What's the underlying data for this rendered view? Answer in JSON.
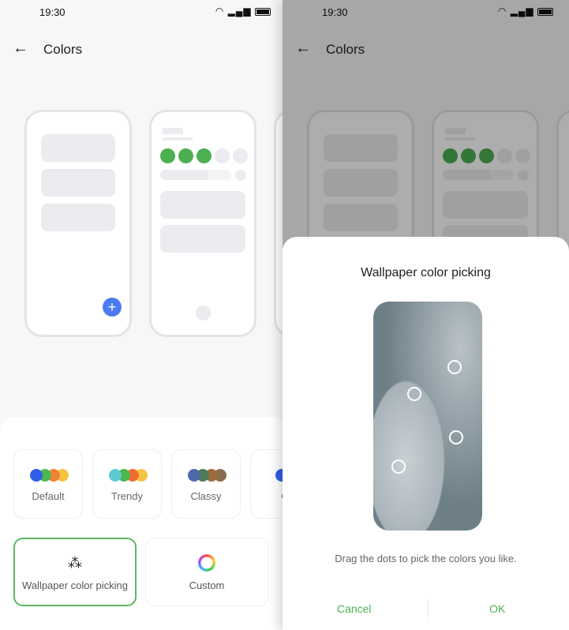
{
  "status": {
    "time": "19:30",
    "icons": "wifi signal battery"
  },
  "header": {
    "back": "←",
    "title": "Colors"
  },
  "themes": [
    {
      "label": "Default",
      "colors": [
        "#2f5ee8",
        "#4db850",
        "#ef8233",
        "#f6c343"
      ]
    },
    {
      "label": "Trendy",
      "colors": [
        "#5dcbd6",
        "#4db850",
        "#ef6c33",
        "#f6c343"
      ]
    },
    {
      "label": "Classy",
      "colors": [
        "#4d6aa8",
        "#4f7a57",
        "#9c6b3d",
        "#8a6b4d"
      ]
    },
    {
      "label": "C",
      "colors": [
        "#2f5ee8",
        "#4db850"
      ]
    }
  ],
  "wallpaper_option": {
    "label": "Wallpaper color picking",
    "icon": "magic-wand-icon"
  },
  "custom_option": {
    "label": "Custom",
    "icon": "color-wheel-icon"
  },
  "accent": "#4caf50",
  "dialog": {
    "title": "Wallpaper color picking",
    "hint": "Drag the dots to pick the colors you like.",
    "cancel": "Cancel",
    "ok": "OK"
  }
}
